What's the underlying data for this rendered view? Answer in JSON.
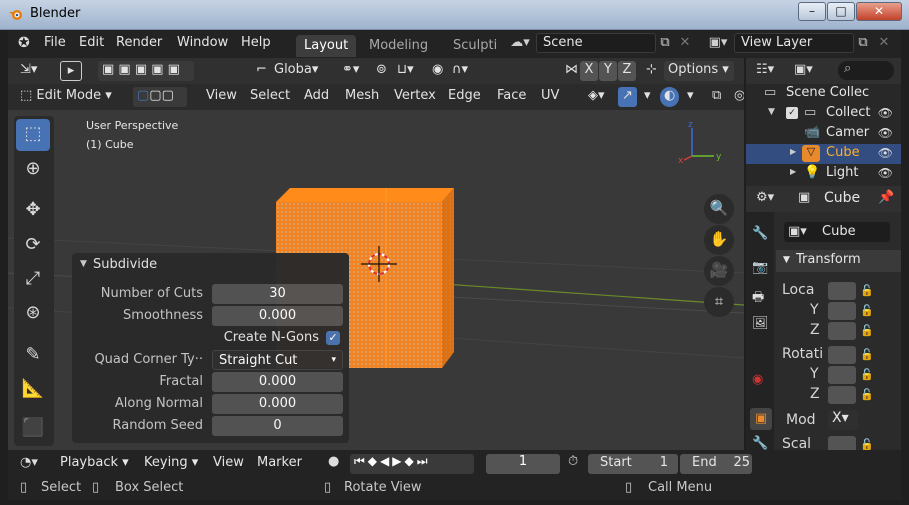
{
  "window": {
    "title": "Blender",
    "min": "–",
    "max": "□",
    "close": "✕"
  },
  "menu": [
    "File",
    "Edit",
    "Render",
    "Window",
    "Help"
  ],
  "workspaces": [
    "Layout",
    "Modeling",
    "Sculpti"
  ],
  "scene": "Scene",
  "view_layer": "View Layer",
  "header": {
    "transform_orientation": "Globa",
    "options": "Options",
    "axes": [
      "X",
      "Y",
      "Z"
    ],
    "mode": "Edit Mode",
    "menus": [
      "View",
      "Select",
      "Add",
      "Mesh",
      "Vertex",
      "Edge",
      "Face",
      "UV"
    ]
  },
  "viewport": {
    "perspective": "User Perspective",
    "object": "(1) Cube",
    "gizmo": {
      "x": "x",
      "y": "y",
      "z": "z"
    }
  },
  "subdivide": {
    "title": "Subdivide",
    "number_of_cuts_label": "Number of Cuts",
    "number_of_cuts": "30",
    "smoothness_label": "Smoothness",
    "smoothness": "0.000",
    "create_ngons_label": "Create N-Gons",
    "create_ngons": true,
    "quad_corner_label": "Quad Corner Ty··",
    "quad_corner": "Straight Cut",
    "fractal_label": "Fractal",
    "fractal": "0.000",
    "along_normal_label": "Along Normal",
    "along_normal": "0.000",
    "random_seed_label": "Random Seed",
    "random_seed": "0"
  },
  "outliner": {
    "search_placeholder": "",
    "rows": [
      {
        "label": "Scene Collec"
      },
      {
        "label": "Collect"
      },
      {
        "label": "Camer"
      },
      {
        "label": "Cube"
      },
      {
        "label": "Light"
      }
    ]
  },
  "properties": {
    "object_name": "Cube",
    "datablock": "Cube",
    "section": "Transform",
    "location_label": "Loca",
    "rotation_label": "Rotati",
    "mode_label": "Mod",
    "mode_value": "X",
    "scale_label": "Scal",
    "y": "Y",
    "z": "Z"
  },
  "timeline": {
    "items": [
      "Playback",
      "Keying",
      "View",
      "Marker"
    ],
    "current_frame": "1",
    "start_label": "Start",
    "start": "1",
    "end_label": "End",
    "end": "25"
  },
  "status": {
    "select": "Select",
    "box_select": "Box Select",
    "rotate_view": "Rotate View",
    "call_menu": "Call Menu"
  },
  "colors": {
    "selected": "#ff7f0e",
    "accent": "#4772b3",
    "bg": "#393939"
  }
}
